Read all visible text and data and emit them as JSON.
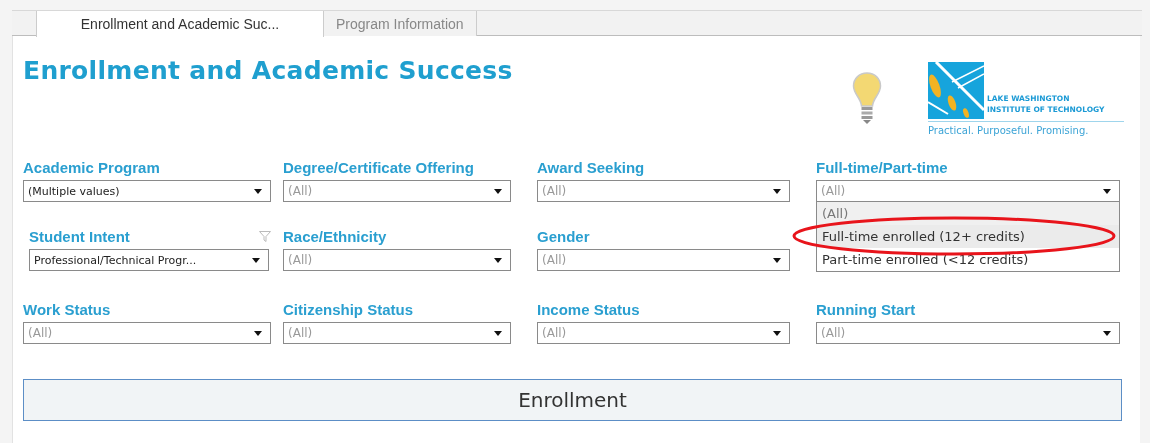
{
  "tabs": [
    {
      "label": "Enrollment and Academic Suc...",
      "selected": true
    },
    {
      "label": "Program Information",
      "selected": false
    }
  ],
  "dashboard": {
    "title": "Enrollment and Academic Success",
    "logo": {
      "name_line_1": "LAKE WASHINGTON",
      "name_line_2": "INSTITUTE OF TECHNOLOGY",
      "tagline": "Practical. Purposeful. Promising."
    }
  },
  "filter_rows": [
    [
      {
        "label": "Academic Program",
        "value": "(Multiple values)",
        "is_default": false,
        "filtered": false
      },
      {
        "label": "Degree/Certificate Offering",
        "value": "(All)",
        "is_default": true,
        "filtered": false
      },
      {
        "label": "Award Seeking",
        "value": "(All)",
        "is_default": true,
        "filtered": false
      },
      {
        "label": "Full-time/Part-time",
        "value": "(All)",
        "is_default": true,
        "filtered": false,
        "expanded": true,
        "options": [
          {
            "label": "(All)",
            "selected": true,
            "hovered": false,
            "circled": false
          },
          {
            "label": "Full-time enrolled (12+ credits)",
            "selected": false,
            "hovered": true,
            "circled": true
          },
          {
            "label": "Part-time enrolled (<12 credits)",
            "selected": false,
            "hovered": false,
            "circled": false
          }
        ]
      }
    ],
    [
      {
        "label": "Student Intent",
        "value": "Professional/Technical Progr...",
        "is_default": false,
        "filtered": true
      },
      {
        "label": "Race/Ethnicity",
        "value": "(All)",
        "is_default": true,
        "filtered": false
      },
      {
        "label": "Gender",
        "value": "(All)",
        "is_default": true,
        "filtered": false
      }
    ],
    [
      {
        "label": "Work Status",
        "value": "(All)",
        "is_default": true,
        "filtered": false
      },
      {
        "label": "Citizenship Status",
        "value": "(All)",
        "is_default": true,
        "filtered": false
      },
      {
        "label": "Income Status",
        "value": "(All)",
        "is_default": true,
        "filtered": false
      },
      {
        "label": "Running Start",
        "value": "(All)",
        "is_default": true,
        "filtered": false
      }
    ]
  ],
  "section_header": "Enrollment"
}
